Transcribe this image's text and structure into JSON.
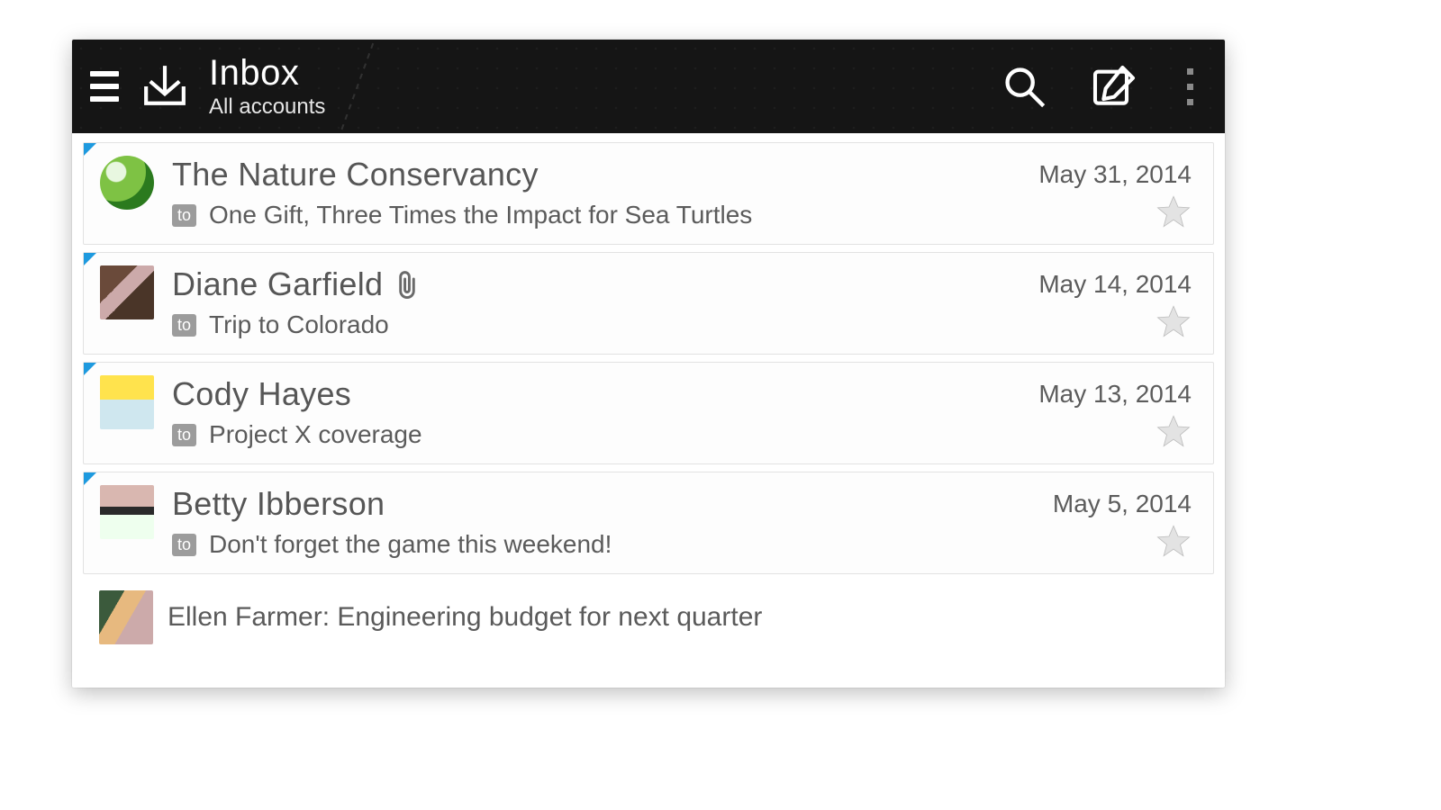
{
  "header": {
    "title": "Inbox",
    "subtitle": "All accounts"
  },
  "labels": {
    "to_badge": "to"
  },
  "messages": [
    {
      "from": "The Nature Conservancy",
      "subject": "One Gift, Three Times the Impact for Sea Turtles",
      "date": "May 31, 2014",
      "attachment": false,
      "unread": true,
      "avatar_class": "av0"
    },
    {
      "from": "Diane Garfield",
      "subject": "Trip to Colorado",
      "date": "May 14, 2014",
      "attachment": true,
      "unread": true,
      "avatar_class": "av1"
    },
    {
      "from": "Cody Hayes",
      "subject": "Project X coverage",
      "date": "May 13, 2014",
      "attachment": false,
      "unread": true,
      "avatar_class": "av2"
    },
    {
      "from": "Betty Ibberson",
      "subject": "Don't forget the game this weekend!",
      "date": "May 5, 2014",
      "attachment": false,
      "unread": true,
      "avatar_class": "av3"
    }
  ],
  "partial": {
    "text": "Ellen Farmer: Engineering budget for next quarter",
    "avatar_class": "av4"
  }
}
